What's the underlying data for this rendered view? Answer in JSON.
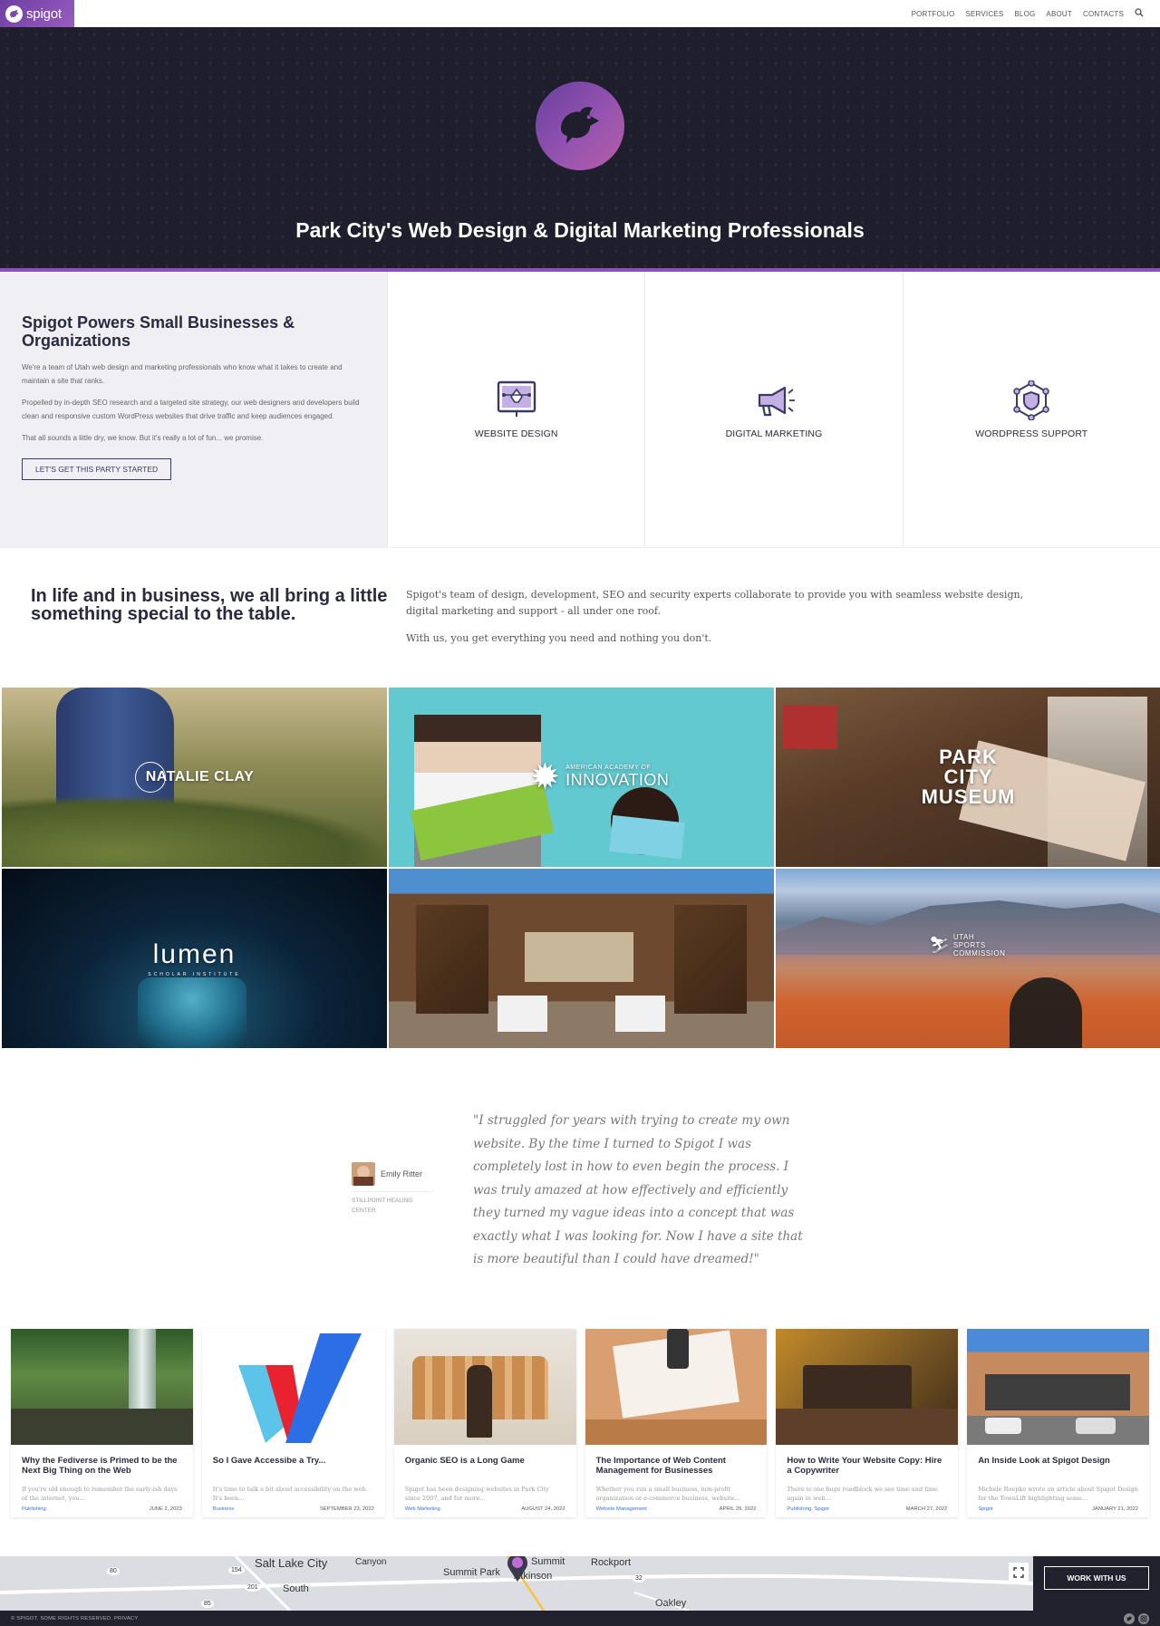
{
  "header": {
    "logo_text": "spigot",
    "nav": [
      "PORTFOLIO",
      "SERVICES",
      "BLOG",
      "ABOUT",
      "CONTACTS"
    ]
  },
  "hero": {
    "title": "Park City's Web Design & Digital Marketing Professionals"
  },
  "services": {
    "heading": "Spigot Powers Small Businesses & Organizations",
    "paragraphs": [
      "We're a team of Utah web design and marketing professionals who know what it takes to create and maintain a site that ranks.",
      "Propelled by in-depth SEO research and a targeted site strategy, our web designers and developers build clean and responsive custom WordPress websites that drive traffic and keep audiences engaged.",
      "That all sounds a little dry, we know. But it's really a lot of fun... we promise."
    ],
    "cta": "LET'S GET THIS PARTY STARTED",
    "items": [
      {
        "label": "WEBSITE DESIGN",
        "icon": "website-design-icon"
      },
      {
        "label": "DIGITAL MARKETING",
        "icon": "megaphone-icon"
      },
      {
        "label": "WORDPRESS SUPPORT",
        "icon": "shield-network-icon"
      }
    ]
  },
  "tagline": {
    "heading": "In life and in business, we all bring a little something special to the table.",
    "paragraphs": [
      "Spigot's team of design, development, SEO and security experts collaborate to provide you with seamless website design, digital marketing and support - all under one roof.",
      "With us, you get everything you need and nothing you don't."
    ]
  },
  "portfolio": [
    {
      "brand": "NATALIE CLAY",
      "sub": ""
    },
    {
      "brand": "INNOVATION",
      "sub": "AMERICAN ACADEMY OF"
    },
    {
      "brand": "PARK CITY MUSEUM",
      "sub": ""
    },
    {
      "brand": "LUMEN",
      "sub": "SCHOLAR INSTITUTE"
    },
    {
      "brand": "",
      "sub": ""
    },
    {
      "brand": "UTAH SPORTS COMMISSION",
      "sub": ""
    }
  ],
  "testimonial": {
    "name": "Emily Ritter",
    "org": "STILLPOINT HEALING CENTER",
    "quote": "\"I struggled for years with trying to create my own website. By the time I turned to Spigot I was completely lost in how to even begin the process. I was truly amazed at how effectively and efficiently they turned my vague ideas into a concept that was exactly what I was looking for. Now I have a site that is more beautiful than I could have dreamed!\""
  },
  "blog": [
    {
      "title": "Why the Fediverse is Primed to be the Next Big Thing on the Web",
      "excerpt": "If you're old enough to remember the early-ish days of the internet, you...",
      "category": "Publishing",
      "date": "JUNE 2, 2023"
    },
    {
      "title": "So I Gave Accessibe a Try...",
      "excerpt": "It's time to talk a bit about accessibility on the web. It's been...",
      "category": "Business",
      "date": "SEPTEMBER 23, 2022"
    },
    {
      "title": "Organic SEO is a Long Game",
      "excerpt": "Spigot has been designing websites in Park City since 2007, and for more...",
      "category": "Web Marketing",
      "date": "AUGUST 24, 2022"
    },
    {
      "title": "The Importance of Web Content Management for Businesses",
      "excerpt": "Whether you run a small business, non-profit organization or e-commerce business, website...",
      "category": "Website Management",
      "date": "APRIL 29, 2022"
    },
    {
      "title": "How to Write Your Website Copy: Hire a Copywriter",
      "excerpt": "There is one huge roadblock we see time and time again in web...",
      "category": "Publishing, Spigot",
      "date": "MARCH 27, 2022"
    },
    {
      "title": "An Inside Look at Spigot Design",
      "excerpt": "Michele Roepke wrote an article about Spigot Design for the TownLift highlighting some...",
      "category": "Spigot",
      "date": "JANUARY 21, 2022"
    }
  ],
  "map": {
    "labels": [
      "Salt Lake City",
      "Canyon",
      "Summit",
      "Summit Park",
      "Atkinson",
      "Rockport",
      "South",
      "Oakley"
    ],
    "roads": [
      "80",
      "154",
      "201",
      "85",
      "32"
    ],
    "cta": "WORK WITH US"
  },
  "footer": {
    "copyright": "© SPIGOT. SOME RIGHTS RESERVED. PRIVACY"
  }
}
